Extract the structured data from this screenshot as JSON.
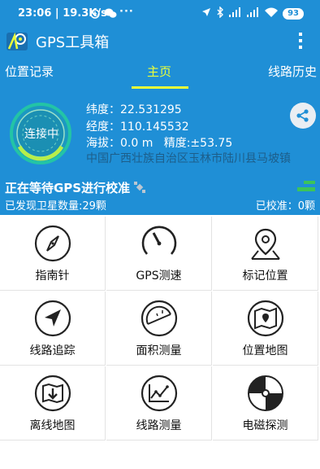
{
  "status_bar": {
    "time": "23:06",
    "speed": "19.3K/s",
    "overflow": "···",
    "battery": "93",
    "icons": [
      "alarm-icon",
      "wechat-icon",
      "location-arrow-icon",
      "bluetooth-icon",
      "signal-icon",
      "wifi-icon"
    ]
  },
  "app": {
    "title": "GPS工具箱",
    "brand_color": "#1f8fd6",
    "accent_color": "#eaff3a"
  },
  "tabs": [
    {
      "label": "位置记录",
      "active": false
    },
    {
      "label": "主页",
      "active": true
    },
    {
      "label": "线路历史",
      "active": false
    }
  ],
  "location": {
    "connection_status": "连接中",
    "latitude": "纬度：22.531295",
    "longitude": "经度：110.145532",
    "altitude": "海拔：0.0 m",
    "accuracy": "精度:±53.75",
    "address": "中国广西壮族自治区玉林市陆川县马坡镇"
  },
  "gps_status": {
    "waiting": "正在等待GPS进行校准",
    "satellites": "已发现卫星数量:29颗",
    "calibrated": "已校准：0颗"
  },
  "tools": [
    {
      "label": "指南针",
      "icon": "compass-icon"
    },
    {
      "label": "GPS测速",
      "icon": "speedometer-icon"
    },
    {
      "label": "标记位置",
      "icon": "map-pin-icon"
    },
    {
      "label": "线路追踪",
      "icon": "navigation-arrow-icon"
    },
    {
      "label": "面积测量",
      "icon": "protractor-icon"
    },
    {
      "label": "位置地图",
      "icon": "folded-map-icon"
    },
    {
      "label": "离线地图",
      "icon": "offline-map-icon"
    },
    {
      "label": "线路测量",
      "icon": "line-chart-icon"
    },
    {
      "label": "电磁探测",
      "icon": "radar-icon"
    }
  ]
}
